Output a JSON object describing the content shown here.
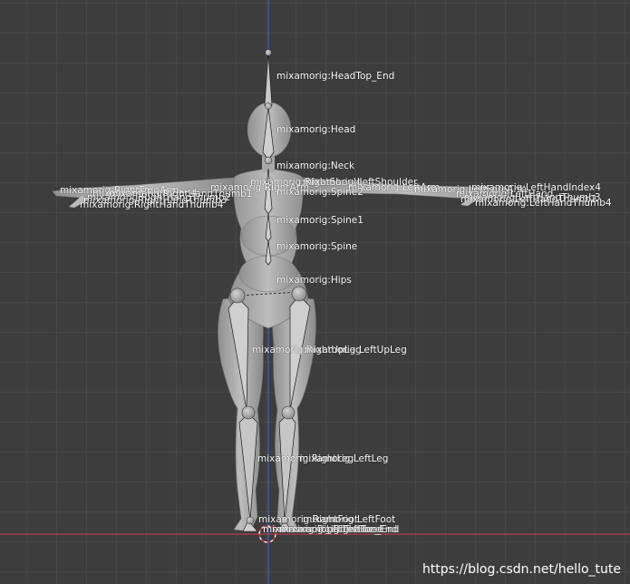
{
  "viewport": {
    "background": "#3d3d3d",
    "x_axis_color": "#b34045",
    "z_axis_color": "#3b64c6"
  },
  "bones": {
    "head_top_end": "mixamorig:HeadTop_End",
    "head": "mixamorig:Head",
    "neck": "mixamorig:Neck",
    "right_shoulder": "mixamorig:RightShoulder",
    "left_shoulder": "mixamorig:LeftShoulder",
    "right_arm": "mixamorig:RightArm",
    "left_arm": "mixamorig:LeftArm",
    "spine2": "mixamorig:Spine2",
    "spine1": "mixamorig:Spine1",
    "spine": "mixamorig:Spine",
    "hips": "mixamorig:Hips",
    "right_up_leg": "mixamorig:RightUpLeg",
    "left_up_leg": "mixamorig:LeftUpLeg",
    "right_leg": "mixamorig:RightLeg",
    "left_leg": "mixamorig:LeftLeg",
    "right_foot": "mixamorig:RightFoot",
    "left_foot": "mixamorig:LeftFoot",
    "right_toe_base": "mixamorig:RightToeBase",
    "left_toe_base": "mixamorig:LeftToeBase",
    "right_toe_end": "mixamorig:RightToe_End",
    "left_toe_end": "mixamorig:LeftToe_End",
    "right_forearm": "mixamorig:RightForeArm",
    "right_hand": "mixamorig:RightHand",
    "right_hand_thumb1": "mixamorig:RightHandThumb1",
    "right_hand_thumb2": "mixamorig:RightHandThumb2",
    "right_hand_thumb3": "mixamorig:RightHandThumb3",
    "right_hand_thumb4": "mixamorig:RightHandThumb4",
    "left_forearm": "mixamorig:LeftForeArm",
    "left_hand": "mixamorig:LeftHand",
    "left_hand_thumb2": "mixamorig:LeftHandThumb2",
    "left_hand_thumb3": "mixamorig:LeftHandThumb3",
    "left_hand_thumb4": "mixamorig:LeftHandThumb4",
    "left_hand_index4": "mixamorig:LeftHandIndex4"
  },
  "watermark": "https://blog.csdn.net/hello_tute"
}
